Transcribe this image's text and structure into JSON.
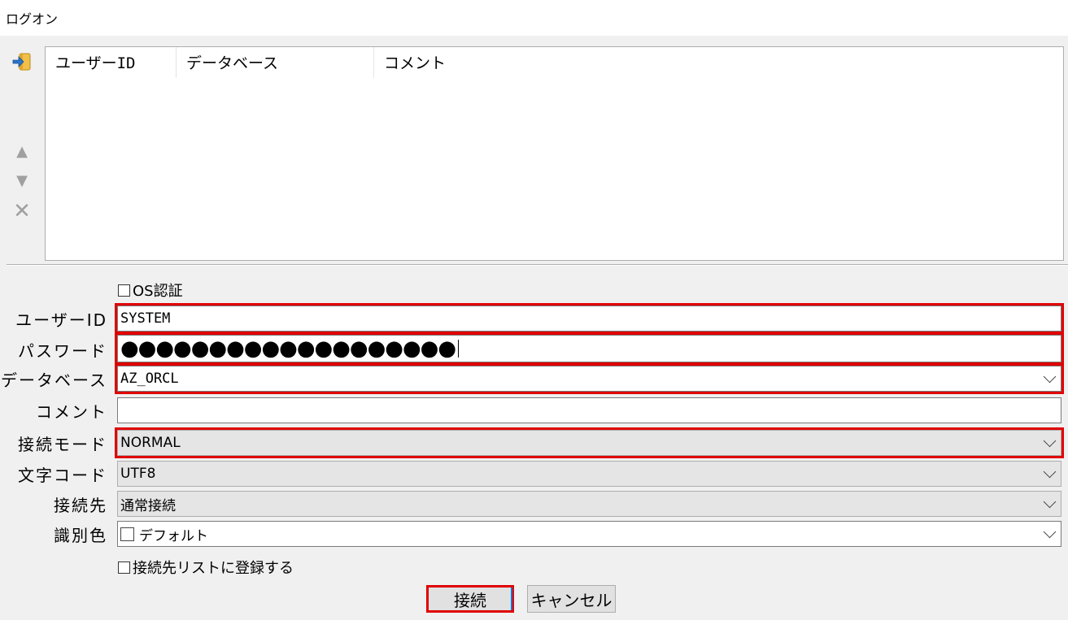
{
  "window": {
    "title": "ログオン"
  },
  "toolbar": {
    "up_glyph": "▲",
    "down_glyph": "▼",
    "delete_glyph": "✕"
  },
  "list": {
    "columns": [
      "ユーザーID",
      "データベース",
      "コメント"
    ]
  },
  "form": {
    "os_auth_label": "OS認証",
    "user_id": {
      "label": "ユーザーID",
      "value": "SYSTEM"
    },
    "password": {
      "label": "パスワード",
      "value": "●●●●●●●●●●●●●●●●●●●"
    },
    "database": {
      "label": "データベース",
      "value": "AZ_ORCL"
    },
    "comment": {
      "label": "コメント",
      "value": ""
    },
    "connect_mode": {
      "label": "接続モード",
      "value": "NORMAL"
    },
    "charset": {
      "label": "文字コード",
      "value": "UTF8"
    },
    "destination": {
      "label": "接続先",
      "value": "通常接続"
    },
    "id_color": {
      "label": "識別色",
      "value": "デフォルト"
    },
    "register_label": "接続先リストに登録する"
  },
  "buttons": {
    "connect": "接続",
    "cancel": "キャンセル"
  },
  "colors": {
    "highlight": "#e00000",
    "focus": "#0078d7"
  }
}
